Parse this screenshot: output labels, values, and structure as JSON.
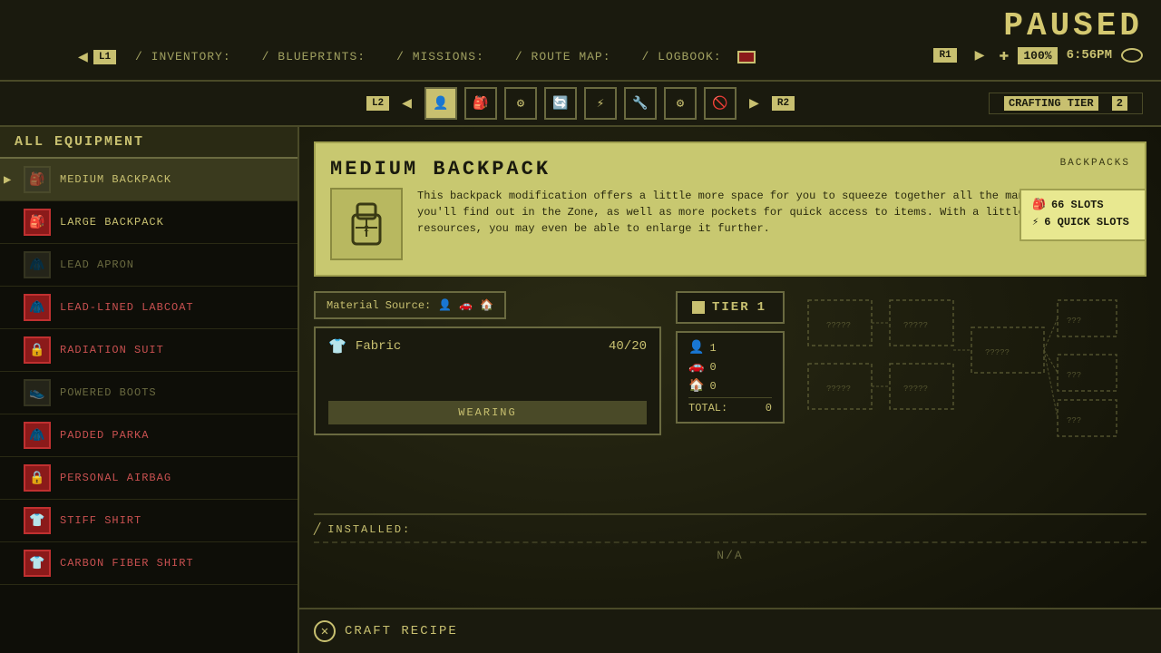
{
  "app": {
    "paused_label": "PAUSED",
    "time": "6:56PM",
    "zoom": "100%"
  },
  "top_nav": {
    "l1_label": "L1",
    "r1_label": "R1",
    "tabs": [
      {
        "label": "/ INVENTORY:",
        "id": "inventory"
      },
      {
        "label": "/ BLUEPRINTS:",
        "id": "blueprints"
      },
      {
        "label": "/ MISSIONS:",
        "id": "missions"
      },
      {
        "label": "/ ROUTE MAP:",
        "id": "routemap"
      },
      {
        "label": "/ LOGBOOK:",
        "id": "logbook"
      }
    ]
  },
  "second_nav": {
    "l2_label": "L2",
    "r2_label": "R2",
    "icons": [
      "👤",
      "🎒",
      "⚙",
      "🔄",
      "⚡",
      "🔧",
      "⚙",
      "🚫"
    ],
    "crafting_tier_label": "CRAFTING TIER",
    "crafting_tier_value": "2"
  },
  "left_panel": {
    "header": "ALL EQUIPMENT",
    "items": [
      {
        "name": "MEDIUM BACKPACK",
        "selected": true,
        "locked": false,
        "red": false,
        "icon": "🎒"
      },
      {
        "name": "LARGE BACKPACK",
        "selected": false,
        "locked": false,
        "red": true,
        "icon": "🎒"
      },
      {
        "name": "LEAD APRON",
        "selected": false,
        "locked": true,
        "red": false,
        "icon": "🧥"
      },
      {
        "name": "LEAD-LINED LABCOAT",
        "selected": false,
        "locked": false,
        "red": true,
        "icon": "🧥"
      },
      {
        "name": "RADIATION SUIT",
        "selected": false,
        "locked": false,
        "red": true,
        "icon": "🔒"
      },
      {
        "name": "POWERED BOOTS",
        "selected": false,
        "locked": true,
        "red": false,
        "icon": "👟"
      },
      {
        "name": "PADDED PARKA",
        "selected": false,
        "locked": false,
        "red": true,
        "icon": "🧥"
      },
      {
        "name": "PERSONAL AIRBAG",
        "selected": false,
        "locked": false,
        "red": true,
        "icon": "🔒"
      },
      {
        "name": "STIFF SHIRT",
        "selected": false,
        "locked": false,
        "red": true,
        "icon": "👕"
      },
      {
        "name": "CARBON FIBER SHIRT",
        "selected": false,
        "locked": false,
        "red": true,
        "icon": "👕"
      }
    ]
  },
  "item_detail": {
    "title": "MEDIUM BACKPACK",
    "subtitle": "BACKPACKS",
    "description": "This backpack modification offers a little more space for you to squeeze together all the many curiosities you'll find out in the Zone, as well as more pockets for quick access to items. With a little more time and resources, you may even be able to enlarge it further.",
    "stats": {
      "slots_label": "66 SLOTS",
      "quick_slots_label": "6 QUICK SLOTS"
    }
  },
  "crafting": {
    "material_source_label": "Material Source:",
    "tier_label": "TIER",
    "tier_value": "1",
    "material_name": "Fabric",
    "material_count": "40/20",
    "wearing_label": "WEARING",
    "resources": {
      "player_count": "1",
      "car_count": "0",
      "home_count": "0",
      "total_label": "TOTAL:",
      "total_value": "0"
    }
  },
  "installed": {
    "label": "INSTALLED:",
    "value": "N/A"
  },
  "craft_recipe": {
    "label": "CRAFT RECIPE"
  }
}
